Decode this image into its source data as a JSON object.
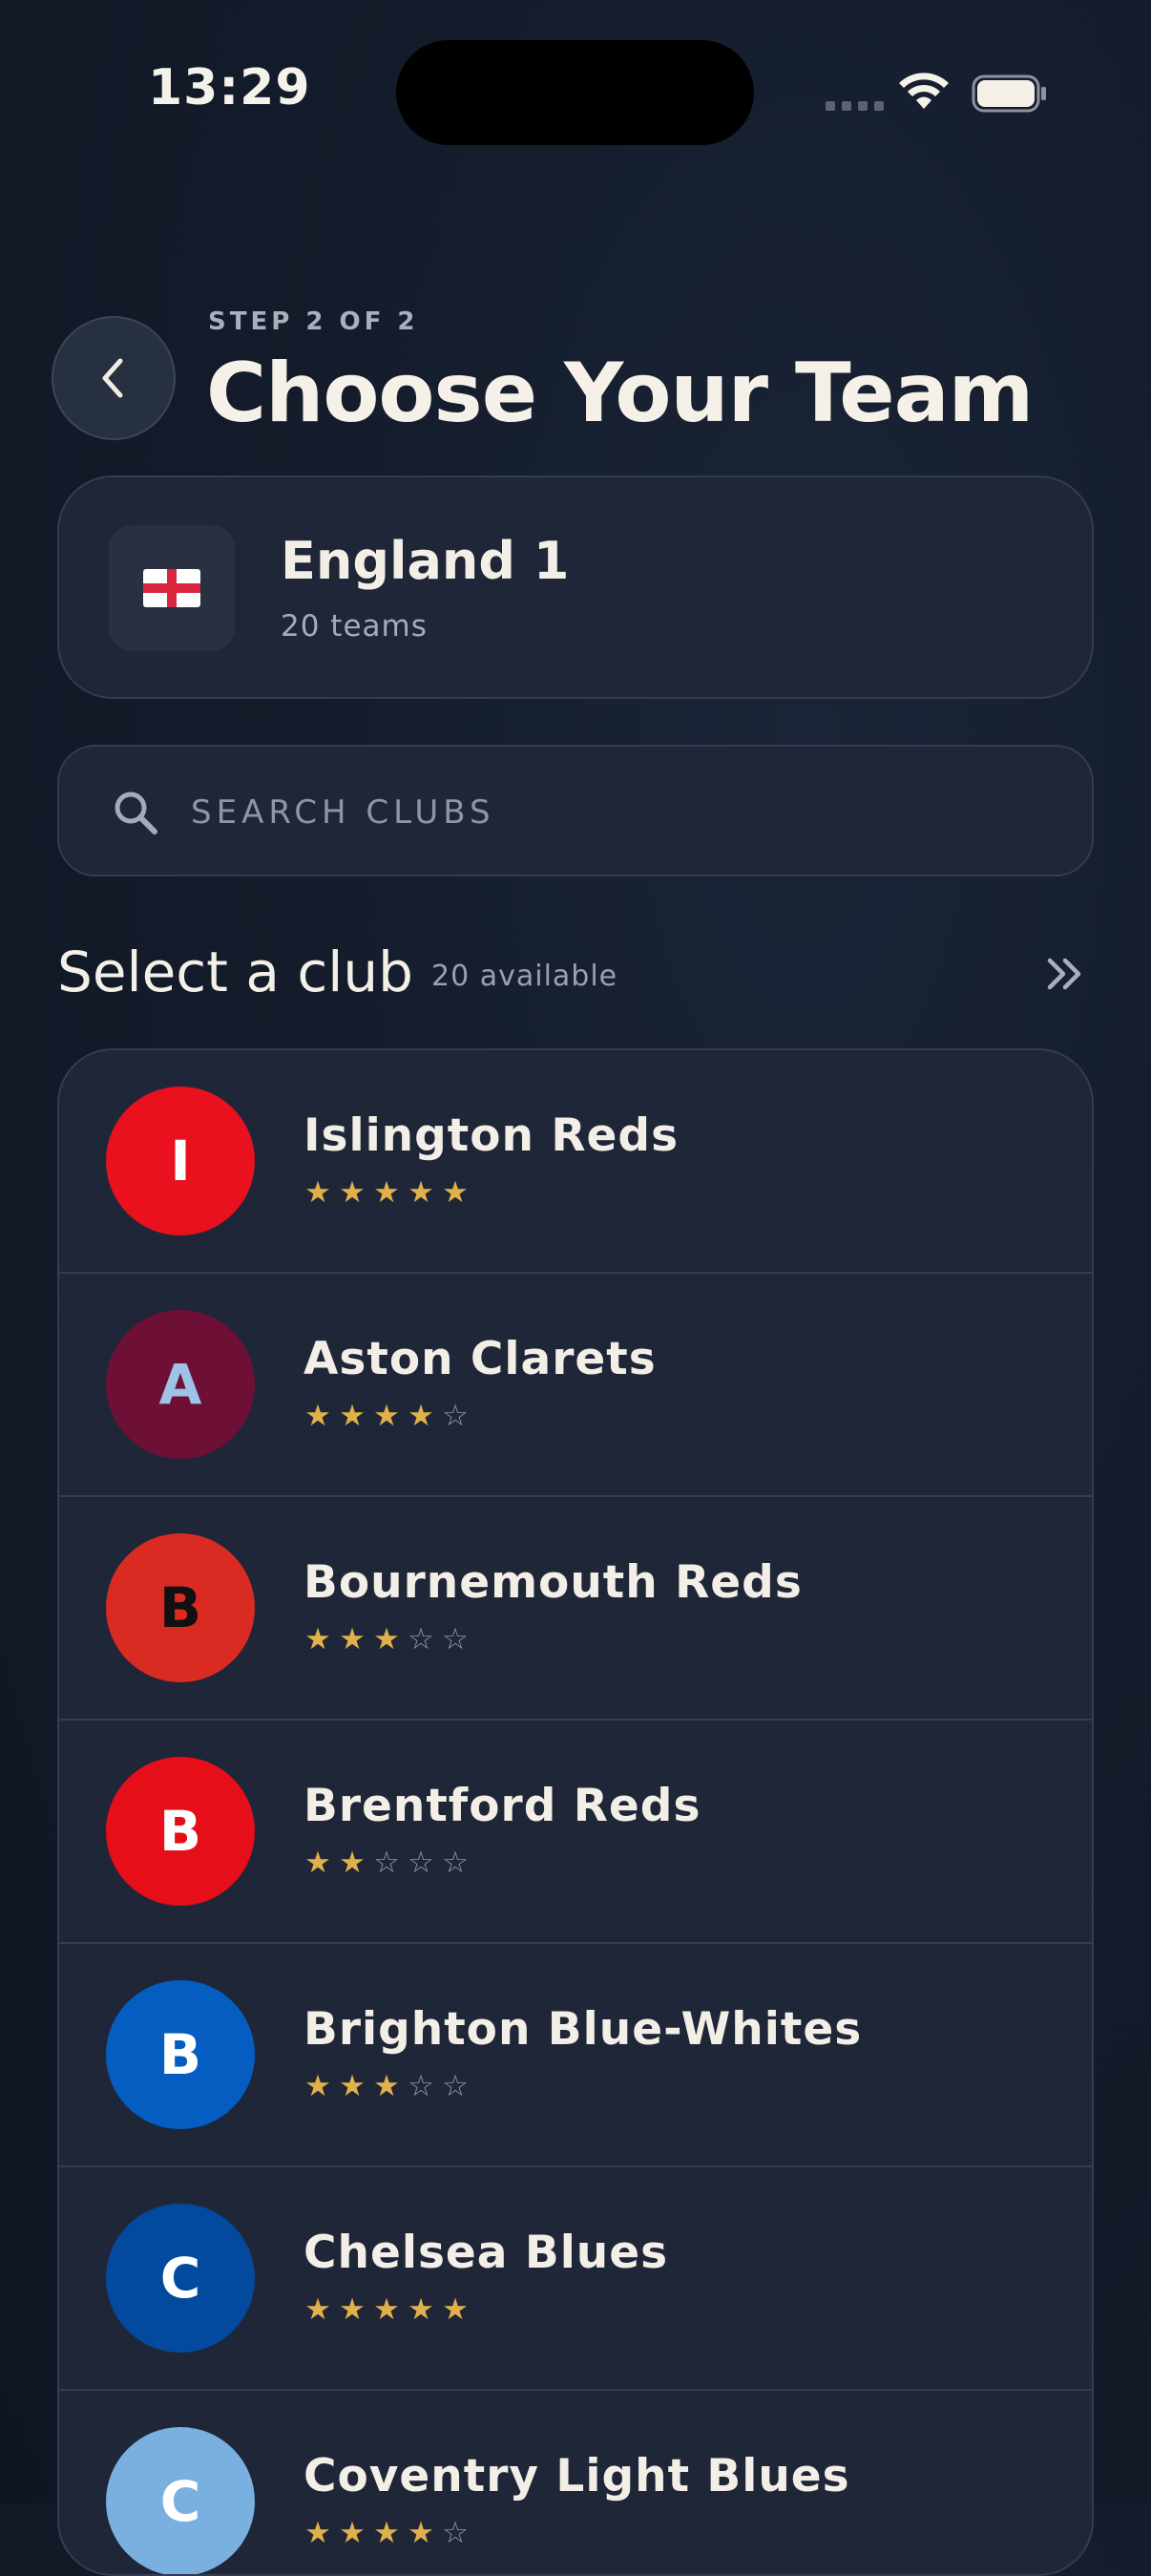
{
  "status_bar": {
    "time": "13:29"
  },
  "header": {
    "step_label": "STEP 2 OF 2",
    "title": "Choose Your Team",
    "back_icon": "chevron-left-icon"
  },
  "league": {
    "name": "England 1",
    "team_count": "20 teams",
    "flag_icon": "england-flag-icon"
  },
  "search": {
    "placeholder": "SEARCH CLUBS",
    "value": "",
    "icon": "search-icon"
  },
  "section": {
    "title": "Select a club",
    "count": "20 available",
    "expand_icon": "double-chevron-right-icon"
  },
  "clubs": [
    {
      "initial": "I",
      "name": "Islington Reds",
      "rating": 5,
      "max_rating": 5,
      "crest_color": "#e8111d",
      "initial_color": "#ffffff"
    },
    {
      "initial": "A",
      "name": "Aston Clarets",
      "rating": 4,
      "max_rating": 5,
      "crest_color": "#6e1035",
      "initial_color": "#9ec3e6"
    },
    {
      "initial": "B",
      "name": "Bournemouth Reds",
      "rating": 3,
      "max_rating": 5,
      "crest_color": "#da2b23",
      "initial_color": "#111111"
    },
    {
      "initial": "B",
      "name": "Brentford Reds",
      "rating": 2,
      "max_rating": 5,
      "crest_color": "#e60e19",
      "initial_color": "#ffffff"
    },
    {
      "initial": "B",
      "name": "Brighton Blue-Whites",
      "rating": 3,
      "max_rating": 5,
      "crest_color": "#055cc1",
      "initial_color": "#ffffff"
    },
    {
      "initial": "C",
      "name": "Chelsea Blues",
      "rating": 5,
      "max_rating": 5,
      "crest_color": "#034a9e",
      "initial_color": "#ffffff"
    },
    {
      "initial": "C",
      "name": "Coventry Light Blues",
      "rating": 4,
      "max_rating": 5,
      "crest_color": "#79b0e0",
      "initial_color": "#ffffff"
    }
  ]
}
